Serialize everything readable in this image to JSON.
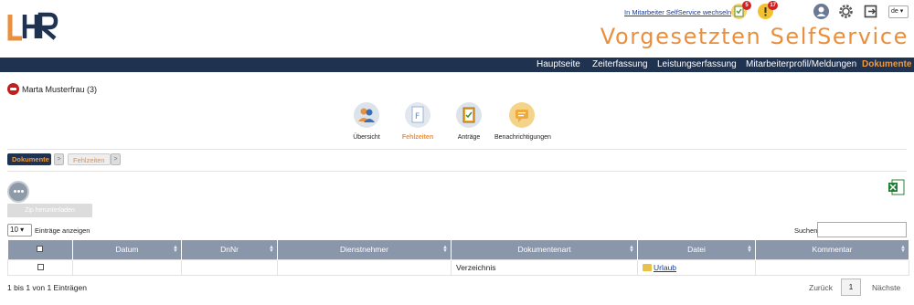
{
  "header": {
    "logo_text": "LHR",
    "switch_link": "In Mitarbeiter SelfService wechseln",
    "badge_tasks": "5",
    "badge_alerts": "17",
    "language": "de",
    "app_title": "Vorgesetzten SelfService",
    "icons": [
      "checklist-icon",
      "alert-icon",
      "user-help-icon",
      "gear-icon",
      "logout-icon"
    ]
  },
  "nav": {
    "items": [
      "Hauptseite",
      "Zeiterfassung",
      "Leistungserfassung",
      "Mitarbeiterprofil/Meldungen",
      "Dokumente"
    ],
    "active_index": 4
  },
  "user": {
    "name": "Marta Musterfrau (3)"
  },
  "tools": [
    {
      "label": "Übersicht"
    },
    {
      "label": "Fehlzeiten"
    },
    {
      "label": "Anträge"
    },
    {
      "label": "Benachrichtigungen"
    }
  ],
  "breadcrumb": {
    "item1": "Dokumente",
    "item2": "Fehlzeiten",
    "arrow": ">"
  },
  "actions": {
    "zip_button": "Zip herunterladen"
  },
  "table_controls": {
    "page_length": "10",
    "page_length_label": "Einträge anzeigen",
    "search_label": "Suchen",
    "search_value": ""
  },
  "table": {
    "headers": [
      "Datum",
      "DnNr",
      "Dienstnehmer",
      "Dokumentenart",
      "Datei",
      "Kommentar"
    ],
    "rows": [
      {
        "datum": "",
        "dnnr": "",
        "dienstnehmer": "",
        "dokumentenart": "Verzeichnis",
        "datei": "Urlaub",
        "kommentar": ""
      }
    ]
  },
  "footer": {
    "info": "1 bis 1 von 1 Einträgen",
    "prev": "Zurück",
    "page": "1",
    "next": "Nächste"
  },
  "colors": {
    "accent": "#e98f3e",
    "nav_bg": "#1f3250",
    "table_header": "#8a96aa",
    "badge": "#d62020"
  }
}
